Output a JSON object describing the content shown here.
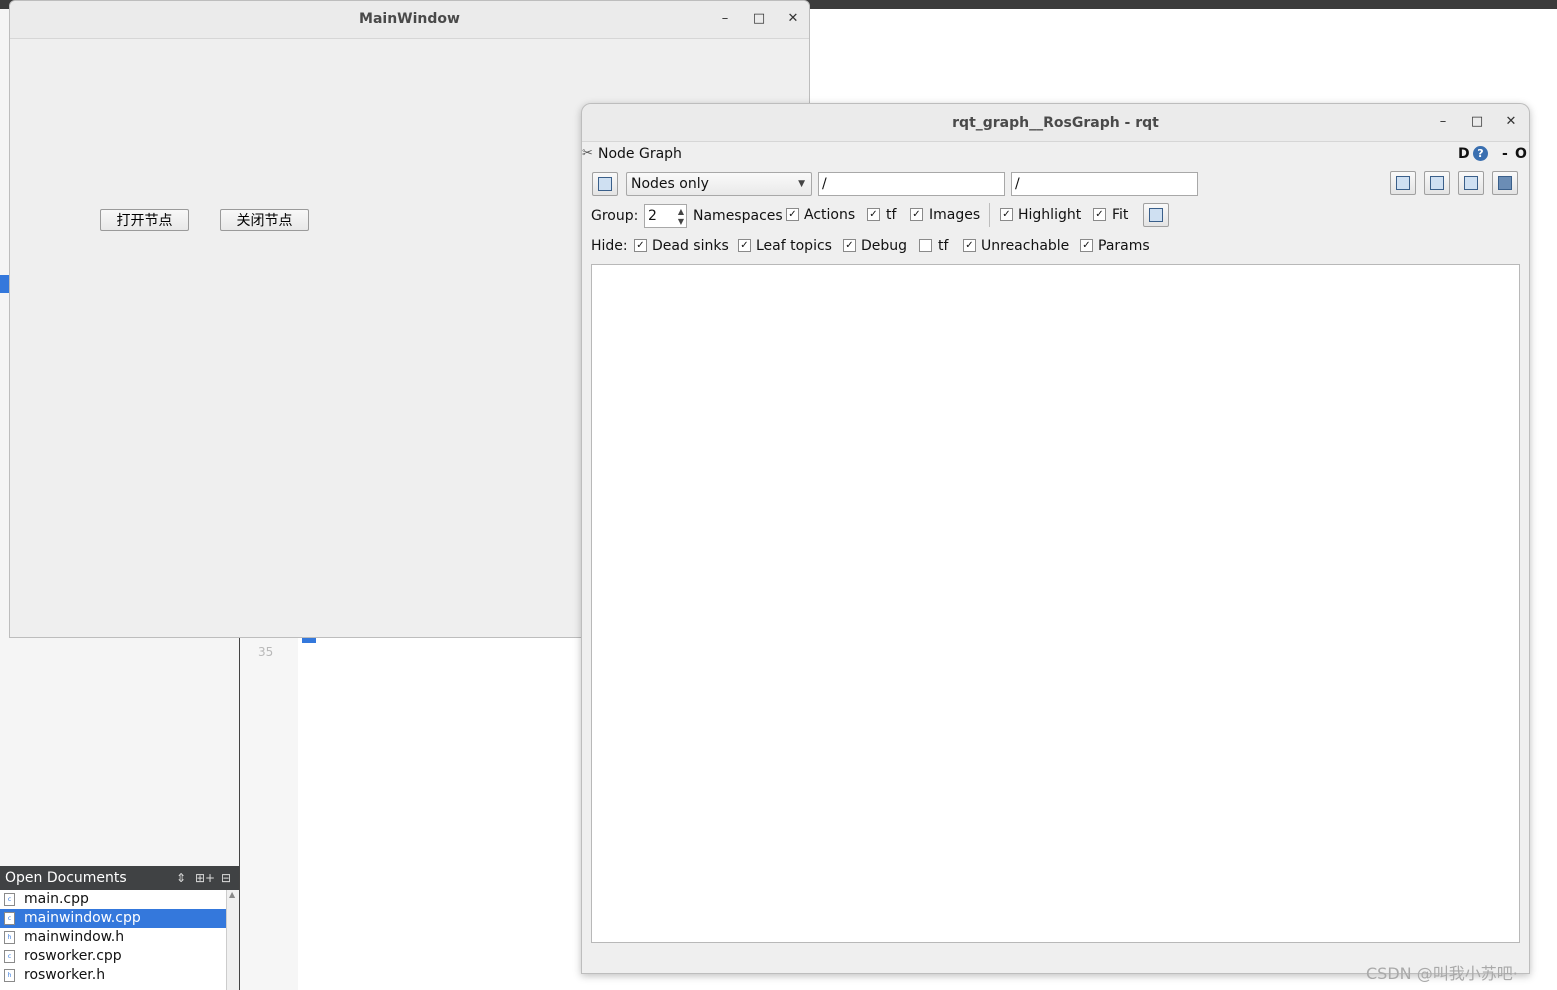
{
  "ide": {
    "line_number": "35",
    "open_documents": {
      "title": "Open Documents",
      "controls": [
        "⇕",
        "⊞+",
        "⊟"
      ],
      "files": [
        {
          "name": "main.cpp",
          "selected": false
        },
        {
          "name": "mainwindow.cpp",
          "selected": true
        },
        {
          "name": "mainwindow.h",
          "selected": false
        },
        {
          "name": "rosworker.cpp",
          "selected": false
        },
        {
          "name": "rosworker.h",
          "selected": false
        }
      ]
    }
  },
  "main_window": {
    "title": "MainWindow",
    "controls": {
      "minimize": "–",
      "maximize": "□",
      "close": "✕"
    },
    "open_node_button": "打开节点",
    "close_node_button": "关闭节点"
  },
  "rqt": {
    "title": "rqt_graph__RosGraph - rqt",
    "controls": {
      "minimize": "–",
      "maximize": "□",
      "close": "✕"
    },
    "plugin_title": "Node Graph",
    "plugin_controls": {
      "d": "D",
      "help": "?",
      "dash": "-",
      "o": "O"
    },
    "graph_type": "Nodes only",
    "node_filter": "/",
    "topic_filter": "/",
    "group_label": "Group:",
    "group_value": "2",
    "group_options": [
      {
        "label": "Namespaces",
        "checked": false,
        "has_box": false
      },
      {
        "label": "Actions",
        "checked": true
      },
      {
        "label": "tf",
        "checked": true
      },
      {
        "label": "Images",
        "checked": true
      },
      {
        "label": "Highlight",
        "checked": true
      },
      {
        "label": "Fit",
        "checked": true
      }
    ],
    "hide_label": "Hide:",
    "hide_options": [
      {
        "label": "Dead sinks",
        "checked": true
      },
      {
        "label": "Leaf topics",
        "checked": true
      },
      {
        "label": "Debug",
        "checked": true
      },
      {
        "label": "tf",
        "checked": false
      },
      {
        "label": "Unreachable",
        "checked": true
      },
      {
        "label": "Params",
        "checked": true
      }
    ],
    "toolbar_icons": [
      "refresh-icon",
      "load-dot-icon",
      "save-dot-icon",
      "save-svg-icon",
      "save-image-icon",
      "fit-view-icon"
    ]
  },
  "watermark": "CSDN @叫我小苏吧·",
  "colors": {
    "selection": "#3478dc",
    "window_bg": "#efefef"
  }
}
